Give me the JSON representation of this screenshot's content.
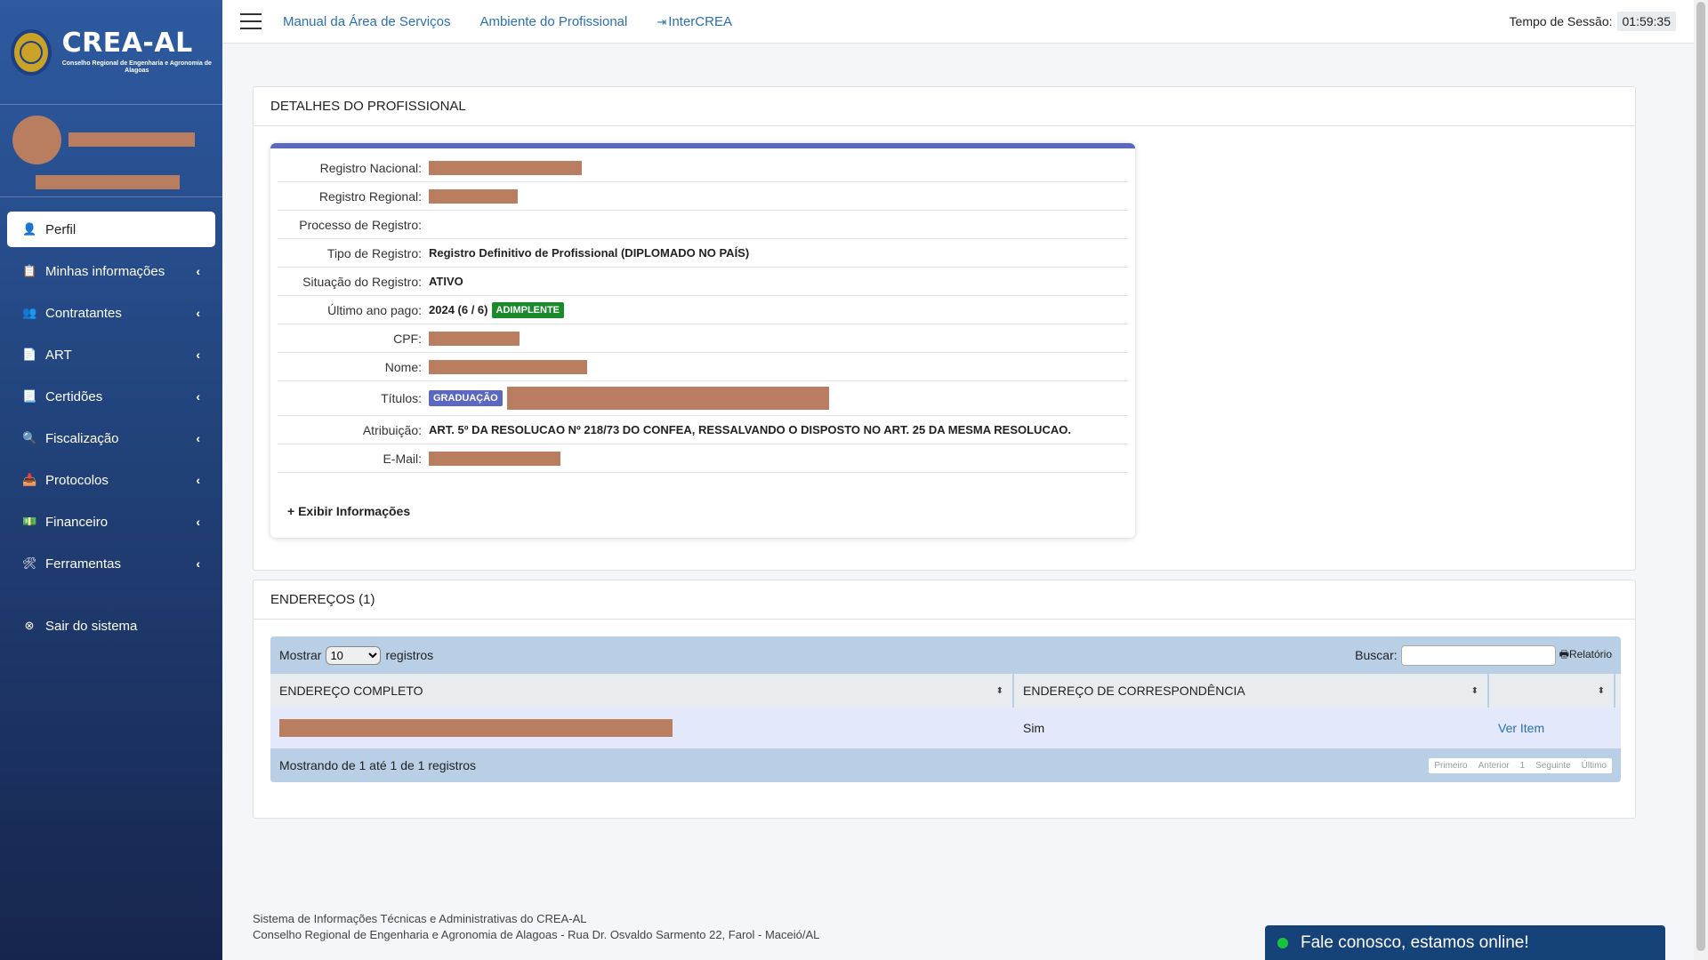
{
  "brand": {
    "title": "CREA-AL",
    "subtitle": "Conselho Regional de Engenharia e Agronomia de Alagoas"
  },
  "sidebar": {
    "items": [
      {
        "label": "Perfil",
        "icon": "user-icon",
        "active": true,
        "glyph": "👤"
      },
      {
        "label": "Minhas informações",
        "icon": "clipboard-icon",
        "glyph": "📋"
      },
      {
        "label": "Contratantes",
        "icon": "users-icon",
        "glyph": "👥"
      },
      {
        "label": "ART",
        "icon": "file-icon",
        "glyph": "📄"
      },
      {
        "label": "Certidões",
        "icon": "certificate-icon",
        "glyph": "📃"
      },
      {
        "label": "Fiscalização",
        "icon": "search-icon",
        "glyph": "🔍"
      },
      {
        "label": "Protocolos",
        "icon": "inbox-icon",
        "glyph": "📥"
      },
      {
        "label": "Financeiro",
        "icon": "money-icon",
        "glyph": "💵"
      },
      {
        "label": "Ferramentas",
        "icon": "tools-icon",
        "glyph": "🛠"
      }
    ],
    "logout": {
      "label": "Sair do sistema",
      "glyph": "⊗"
    }
  },
  "navbar": {
    "links": [
      "Manual da Área de Serviços",
      "Ambiente do Profissional",
      "InterCREA"
    ],
    "session_label": "Tempo de Sessão:",
    "session_time": "01:59:35"
  },
  "details": {
    "header": "DETALHES DO PROFISSIONAL",
    "labels": {
      "registro_nacional": "Registro Nacional:",
      "registro_regional": "Registro Regional:",
      "processo": "Processo de Registro:",
      "tipo": "Tipo de Registro:",
      "situacao": "Situação do Registro:",
      "ultimo_ano": "Último ano pago:",
      "cpf": "CPF:",
      "nome": "Nome:",
      "titulos": "Títulos:",
      "atribuicao": "Atribuição:",
      "email": "E-Mail:"
    },
    "values": {
      "tipo": "Registro Definitivo de Profissional (DIPLOMADO NO PAÍS)",
      "situacao": "ATIVO",
      "ultimo_ano": "2024 (6 / 6)",
      "ultimo_ano_badge": "ADIMPLENTE",
      "titulos_badge": "GRADUAÇÃO",
      "atribuicao": "ART. 5º DA RESOLUCAO Nº 218/73 DO CONFEA, RESSALVANDO O DISPOSTO NO ART. 25 DA MESMA RESOLUCAO."
    },
    "more_info": "+ Exibir Informações"
  },
  "addresses": {
    "header": "ENDEREÇOS (1)",
    "show_label": "Mostrar",
    "show_value": "10",
    "records_label": "registros",
    "search_label": "Buscar:",
    "report_label": "Relatório",
    "columns": [
      "ENDEREÇO COMPLETO",
      "ENDEREÇO DE CORRESPONDÊNCIA",
      ""
    ],
    "row": {
      "correspondencia": "Sim",
      "action": "Ver Item"
    },
    "info": "Mostrando de 1 até 1 de 1 registros",
    "pager": [
      "Primeiro",
      "Anterior",
      "1",
      "Seguinte",
      "Último"
    ]
  },
  "footer": {
    "line1": "Sistema de Informações Técnicas e Administrativas do CREA-AL",
    "line2": "Conselho Regional de Engenharia e Agronomia de Alagoas - Rua Dr. Osvaldo Sarmento 22, Farol - Maceió/AL"
  },
  "chat": {
    "label": "Fale conosco, estamos online!"
  },
  "colors": {
    "accent": "#5a68c4",
    "success": "#1a8a2b",
    "link": "#2a6fb5",
    "redacted": "#b97d60"
  }
}
